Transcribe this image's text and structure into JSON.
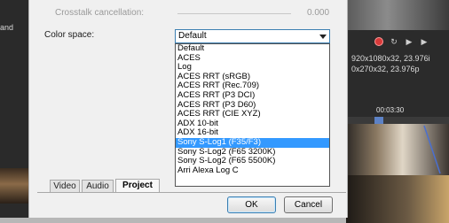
{
  "background": {
    "left_text": "and",
    "video_info_1": "920x1080x32, 23.976i",
    "video_info_2": "0x270x32, 23.976p",
    "timecode": "00:03:30"
  },
  "dialog": {
    "crosstalk_label": "Crosstalk cancellation:",
    "crosstalk_value": "0.000",
    "color_space_label": "Color space:",
    "color_space_value": "Default",
    "options": [
      {
        "label": "Default"
      },
      {
        "label": "ACES"
      },
      {
        "label": "Log"
      },
      {
        "label": "ACES RRT (sRGB)"
      },
      {
        "label": "ACES RRT (Rec.709)"
      },
      {
        "label": "ACES RRT (P3 DCI)"
      },
      {
        "label": "ACES RRT (P3 D60)"
      },
      {
        "label": "ACES RRT (CIE XYZ)"
      },
      {
        "label": "ADX 10-bit"
      },
      {
        "label": "ADX 16-bit"
      },
      {
        "label": "Sony S-Log1 (F35/F3)",
        "selected": true
      },
      {
        "label": "Sony S-Log2 (F65 3200K)"
      },
      {
        "label": "Sony S-Log2 (F65 5500K)"
      },
      {
        "label": "Arri Alexa Log C"
      }
    ],
    "tabs": [
      {
        "label": "Video"
      },
      {
        "label": "Audio"
      },
      {
        "label": "Project",
        "active": true
      }
    ],
    "ok_label": "OK",
    "cancel_label": "Cancel"
  },
  "colors": {
    "selection": "#3399ff",
    "focus_border": "#3c7fb1",
    "record": "#d83a3a"
  }
}
